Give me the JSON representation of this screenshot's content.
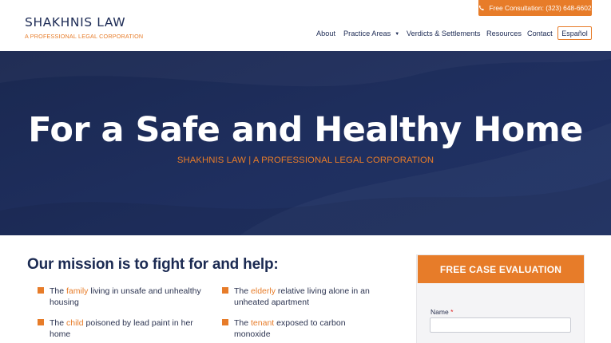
{
  "header": {
    "logo_name": "SHAKHNIS LAW",
    "logo_tagline": "A PROFESSIONAL LEGAL CORPORATION",
    "cta_label": "Free Consultation: (323) 648-6602",
    "nav": [
      {
        "label": "About"
      },
      {
        "label": "Practice Areas",
        "has_dropdown": true
      },
      {
        "label": "Verdicts & Settlements"
      },
      {
        "label": "Resources"
      },
      {
        "label": "Contact"
      }
    ],
    "language_label": "Español"
  },
  "hero": {
    "title": "For a Safe and Healthy Home",
    "subtitle": "SHAKHNIS LAW | A PROFESSIONAL LEGAL CORPORATION"
  },
  "mission": {
    "title": "Our mission is to fight for and help:",
    "items": [
      {
        "pre": "The ",
        "highlight": "family",
        "post": " living in unsafe and unhealthy housing"
      },
      {
        "pre": "The ",
        "highlight": "elderly",
        "post": " relative living alone in an unheated apartment"
      },
      {
        "pre": "The ",
        "highlight": "child",
        "post": " poisoned by lead paint in her home"
      },
      {
        "pre": "The ",
        "highlight": "tenant",
        "post": " exposed to carbon monoxide"
      }
    ]
  },
  "form": {
    "heading": "FREE CASE EVALUATION",
    "name_label": "Name",
    "required_mark": "*"
  },
  "colors": {
    "brand_navy": "#1d2b55",
    "brand_orange": "#e77c29"
  },
  "icons": {
    "cta_icon": "phone-icon",
    "nav_dropdown_icon": "caret-down-icon"
  }
}
